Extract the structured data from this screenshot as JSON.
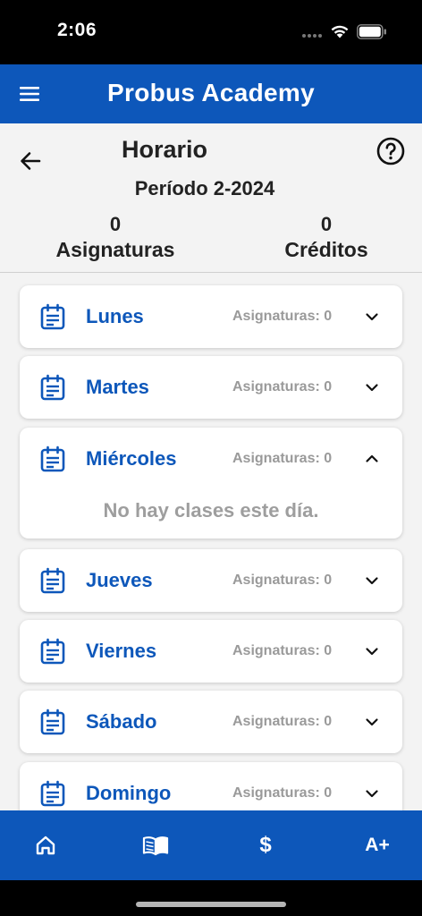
{
  "status_bar": {
    "time": "2:06"
  },
  "app_bar": {
    "title": "Probus Academy"
  },
  "header": {
    "title": "Horario",
    "period": "Período 2-2024",
    "subjects_value": "0",
    "subjects_label": "Asignaturas",
    "credits_value": "0",
    "credits_label": "Créditos"
  },
  "days": [
    {
      "name": "Lunes",
      "count_label": "Asignaturas: 0",
      "expanded": false
    },
    {
      "name": "Martes",
      "count_label": "Asignaturas: 0",
      "expanded": false
    },
    {
      "name": "Miércoles",
      "count_label": "Asignaturas: 0",
      "expanded": true,
      "empty_message": "No hay clases este día."
    },
    {
      "name": "Jueves",
      "count_label": "Asignaturas: 0",
      "expanded": false
    },
    {
      "name": "Viernes",
      "count_label": "Asignaturas: 0",
      "expanded": false
    },
    {
      "name": "Sábado",
      "count_label": "Asignaturas: 0",
      "expanded": false
    },
    {
      "name": "Domingo",
      "count_label": "Asignaturas: 0",
      "expanded": false
    }
  ],
  "bottom_nav": {
    "home_icon": "home-icon",
    "book_icon": "book-icon",
    "money_label": "$",
    "grades_label": "A+"
  },
  "colors": {
    "primary": "#0d57ba",
    "background": "#f3f3f3",
    "muted_text": "#9a9a9a"
  }
}
